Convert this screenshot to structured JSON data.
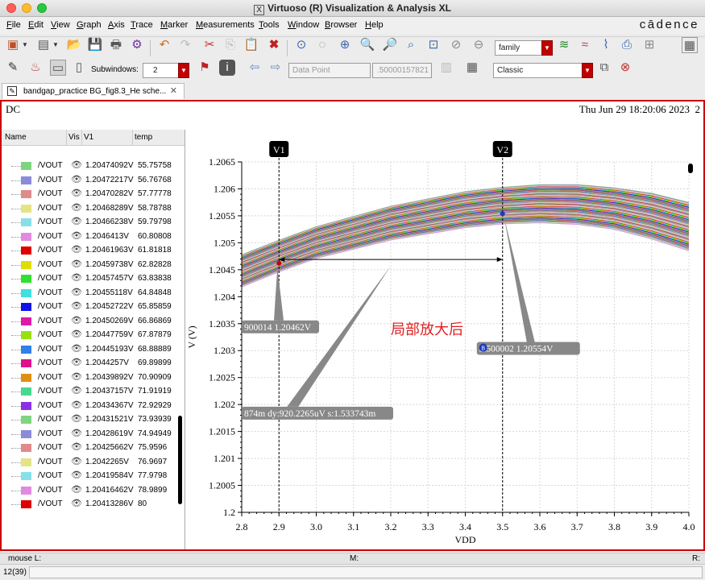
{
  "window": {
    "title": "Virtuoso (R) Visualization & Analysis XL",
    "brand": "cādence"
  },
  "menu": [
    {
      "label": "File",
      "u": "F",
      "rest": "ile"
    },
    {
      "label": "Edit",
      "u": "E",
      "rest": "dit"
    },
    {
      "label": "View",
      "u": "V",
      "rest": "iew"
    },
    {
      "label": "Graph",
      "u": "G",
      "rest": "raph"
    },
    {
      "label": "Axis",
      "u": "A",
      "rest": "xis"
    },
    {
      "label": "Trace",
      "u": "T",
      "rest": "race"
    },
    {
      "label": "Marker",
      "u": "M",
      "rest": "arker"
    },
    {
      "label": "Measurements",
      "u": "M",
      "rest": "easurements"
    },
    {
      "label": "Tools",
      "u": "T",
      "rest": "ools",
      "pre": ""
    },
    {
      "label": "Window",
      "u": "W",
      "rest": "indow"
    },
    {
      "label": "Browser",
      "u": "B",
      "rest": "rowser"
    },
    {
      "label": "Help",
      "u": "H",
      "rest": "elp"
    }
  ],
  "toolbar": {
    "family_value": "family",
    "subwindows_label": "Subwindows:",
    "subwindows_value": "2",
    "datapoint_value": "Data Point",
    "datapoint_number": ".50000157821",
    "classic_value": "Classic"
  },
  "tab": {
    "label": "bandgap_practice BG_fig8.3_He sche..."
  },
  "plot": {
    "analysis": "DC",
    "timestamp": "Thu Jun 29 18:20:06 2023",
    "subwindow_number": "2",
    "annotation": "局部放大后",
    "marker_v1_label": "V1",
    "marker_v2_label": "V2",
    "label_v1": "900014 1.20462V",
    "label_delta": "874m dy:920.2265uV s:1.533743m",
    "label_b": "3.500002 1.20554V",
    "marker_a_letter": "A",
    "marker_b_letter": "B"
  },
  "legend": {
    "headers": {
      "name": "Name",
      "vis": "Vis",
      "v1": "V1",
      "temp": "temp"
    },
    "rows": [
      {
        "name": "/VOUT",
        "color": "#7fd47f",
        "v1": "1.20474092V",
        "temp": "55.75758"
      },
      {
        "name": "/VOUT",
        "color": "#8b8bdc",
        "v1": "1.20472217V",
        "temp": "56.76768"
      },
      {
        "name": "/VOUT",
        "color": "#e08a8a",
        "v1": "1.20470282V",
        "temp": "57.77778"
      },
      {
        "name": "/VOUT",
        "color": "#e4e484",
        "v1": "1.20468289V",
        "temp": "58.78788"
      },
      {
        "name": "/VOUT",
        "color": "#86e0e8",
        "v1": "1.20466238V",
        "temp": "59.79798"
      },
      {
        "name": "/VOUT",
        "color": "#e28ae2",
        "v1": "1.2046413V",
        "temp": "60.80808"
      },
      {
        "name": "/VOUT",
        "color": "#e00000",
        "v1": "1.20461963V",
        "temp": "61.81818"
      },
      {
        "name": "/VOUT",
        "color": "#dede00",
        "v1": "1.20459738V",
        "temp": "62.82828"
      },
      {
        "name": "/VOUT",
        "color": "#30e030",
        "v1": "1.20457457V",
        "temp": "63.83838"
      },
      {
        "name": "/VOUT",
        "color": "#3ee0e0",
        "v1": "1.20455118V",
        "temp": "64.84848"
      },
      {
        "name": "/VOUT",
        "color": "#1212e8",
        "v1": "1.20452722V",
        "temp": "65.85859"
      },
      {
        "name": "/VOUT",
        "color": "#e018a8",
        "v1": "1.20450269V",
        "temp": "66.86869"
      },
      {
        "name": "/VOUT",
        "color": "#9ae010",
        "v1": "1.20447759V",
        "temp": "67.87879"
      },
      {
        "name": "/VOUT",
        "color": "#3080e8",
        "v1": "1.20445193V",
        "temp": "68.88889"
      },
      {
        "name": "/VOUT",
        "color": "#e0108a",
        "v1": "1.2044257V",
        "temp": "69.89899"
      },
      {
        "name": "/VOUT",
        "color": "#e09010",
        "v1": "1.20439892V",
        "temp": "70.90909"
      },
      {
        "name": "/VOUT",
        "color": "#48d890",
        "v1": "1.20437157V",
        "temp": "71.91919"
      },
      {
        "name": "/VOUT",
        "color": "#8a30e8",
        "v1": "1.20434367V",
        "temp": "72.92929"
      },
      {
        "name": "/VOUT",
        "color": "#7fd47f",
        "v1": "1.20431521V",
        "temp": "73.93939"
      },
      {
        "name": "/VOUT",
        "color": "#8b8bdc",
        "v1": "1.20428619V",
        "temp": "74.94949"
      },
      {
        "name": "/VOUT",
        "color": "#e08a8a",
        "v1": "1.20425662V",
        "temp": "75.9596"
      },
      {
        "name": "/VOUT",
        "color": "#e4e484",
        "v1": "1.2042265V",
        "temp": "76.9697"
      },
      {
        "name": "/VOUT",
        "color": "#86e0e8",
        "v1": "1.20419584V",
        "temp": "77.9798"
      },
      {
        "name": "/VOUT",
        "color": "#e28ae2",
        "v1": "1.20416462V",
        "temp": "78.9899"
      },
      {
        "name": "/VOUT",
        "color": "#e00000",
        "v1": "1.20413286V",
        "temp": "80"
      }
    ]
  },
  "status": {
    "mouse_l": "mouse L:",
    "m": "M:",
    "r": "R:",
    "count": "12(39)"
  },
  "chart_data": {
    "type": "line",
    "xlabel": "VDD",
    "ylabel": "V (V)",
    "xlim": [
      2.8,
      4.0
    ],
    "ylim": [
      1.2,
      1.2065
    ],
    "xticks": [
      "2.8",
      "2.9",
      "3.0",
      "3.1",
      "3.2",
      "3.3",
      "3.4",
      "3.5",
      "3.6",
      "3.7",
      "3.8",
      "3.9",
      "4.0"
    ],
    "yticks": [
      "1.2",
      "1.2005",
      "1.201",
      "1.2015",
      "1.202",
      "1.2025",
      "1.203",
      "1.2035",
      "1.204",
      "1.2045",
      "1.205",
      "1.2055",
      "1.206",
      "1.2065"
    ],
    "markers": {
      "V1": 2.9,
      "V2": 3.5
    },
    "marker_points": [
      {
        "x": 2.9,
        "y": 1.20462
      },
      {
        "x": 3.5,
        "y": 1.20554
      }
    ],
    "series_envelope": {
      "x": [
        2.8,
        2.9,
        3.0,
        3.2,
        3.4,
        3.5,
        3.6,
        3.7,
        3.8,
        3.9,
        4.0
      ],
      "top": [
        1.20478,
        1.20505,
        1.2053,
        1.20568,
        1.20595,
        1.20603,
        1.20608,
        1.20608,
        1.20602,
        1.20592,
        1.20575
      ],
      "bottom": [
        1.20418,
        1.20446,
        1.20471,
        1.20505,
        1.20528,
        1.20535,
        1.20537,
        1.20534,
        1.20525,
        1.20507,
        1.20485
      ]
    },
    "series_count": 99
  }
}
